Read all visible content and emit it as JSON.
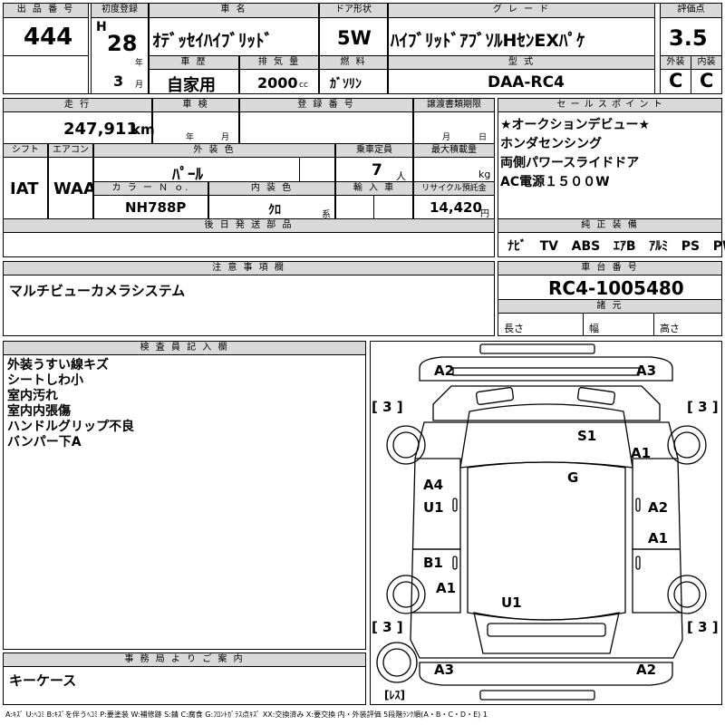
{
  "lot": {
    "header": "出 品 番 号",
    "value": "444"
  },
  "first_reg": {
    "header": "初度登録",
    "era": "H",
    "year": "28",
    "year_unit": "年",
    "month": "3",
    "month_unit": "月"
  },
  "car_name": {
    "header": "車 名",
    "value": "ｵﾃﾞｯｾｲﾊｲﾌﾞﾘｯﾄﾞ"
  },
  "door": {
    "header": "ドア形状",
    "value": "5W"
  },
  "grade": {
    "header": "グ レ ー ド",
    "value": "ﾊｲﾌﾞﾘｯﾄﾞｱﾌﾞｿﾙHｾﾝEXﾊﾟｹ"
  },
  "score": {
    "header": "評価点",
    "value": "3.5",
    "ext_header": "外装",
    "int_header": "内装",
    "ext": "C",
    "int": "C"
  },
  "history": {
    "header": "車 歴",
    "value": "自家用"
  },
  "displacement": {
    "header": "排 気 量",
    "value": "2000",
    "unit": "cc"
  },
  "fuel": {
    "header": "燃 料",
    "value": "ｶﾞｿﾘﾝ"
  },
  "model": {
    "header": "型 式",
    "value": "DAA-RC4"
  },
  "mileage": {
    "header": "走 行",
    "value": "247,911",
    "unit": "km"
  },
  "inspection": {
    "header": "車 検",
    "year_unit": "年",
    "month_unit": "月"
  },
  "reg_number": {
    "header": "登 録 番 号"
  },
  "transfer": {
    "header": "譲渡書類期限",
    "month_unit": "月",
    "day_unit": "日"
  },
  "selling_points": {
    "header": "セ ー ル ス ポ イ ン ト",
    "items": [
      "★オークションデビュー★",
      "ホンダセンシング",
      "両側パワースライドドア",
      "AC電源１５００W"
    ]
  },
  "shift": {
    "header": "シフト",
    "value": "IAT"
  },
  "aircon": {
    "header": "エアコン",
    "value": "WAA"
  },
  "ext_color": {
    "header": "外 装 色",
    "value": "ﾊﾟｰﾙ"
  },
  "capacity": {
    "header": "乗車定員",
    "value": "7",
    "unit": "人"
  },
  "max_load": {
    "header": "最大積載量",
    "unit": "kg"
  },
  "color_no": {
    "header": "カ ラ ー Ｎ ｏ.",
    "value": "NH788P"
  },
  "int_color": {
    "header": "内 装 色",
    "value": "ｸﾛ",
    "unit": "系"
  },
  "import": {
    "header": "輸 入 車"
  },
  "recycle": {
    "header": "リサイクル預託金",
    "value": "14,420",
    "unit": "円"
  },
  "later_parts": {
    "header": "後 日 発 送 部 品"
  },
  "equipment": {
    "header": "純 正 装 備",
    "items": [
      "ﾅﾋﾞ",
      "TV",
      "ABS",
      "ｴｱB",
      "ｱﾙﾐ",
      "PS",
      "PW"
    ]
  },
  "notes": {
    "header": "注 意 事 項 欄",
    "value": "マルチビューカメラシステム"
  },
  "chassis": {
    "header": "車 台 番 号",
    "value": "RC4-1005480"
  },
  "specs": {
    "header": "諸 元",
    "length": "長さ",
    "width": "幅",
    "height": "高さ"
  },
  "inspector": {
    "header": "検 査 員 記 入 欄",
    "items": [
      "外装うすい線キズ",
      "シートしわ小",
      "室内汚れ",
      "室内内張傷",
      "ハンドルグリップ不良",
      "バンパー下A"
    ]
  },
  "office": {
    "header": "事 務 局 よ り ご 案 内",
    "value": "キーケース"
  },
  "diagram": {
    "front_left": "A2",
    "front_right": "A3",
    "tire_fl": "[ 3 ]",
    "tire_fr": "[ 3 ]",
    "roof": "S1",
    "right_front_fender": "A1",
    "windshield": "G",
    "left_front_door": "A4",
    "left_front_door_2": "U1",
    "right_front_door": "A2",
    "right_rear_door": "A1",
    "left_rear_door": "B1",
    "left_rear_fender": "A1",
    "rear_hatch": "U1",
    "tire_rl": "[ 3 ]",
    "tire_rr": "[ 3 ]",
    "rear_left": "A3",
    "rear_right": "A2",
    "spare": "[ﾚｽ]"
  },
  "legend": "A:ｷｽﾞ U:ﾍｺﾐ B:ｷｽﾞを伴うﾍｺﾐ P:要塗装 W:補修跡 S:錆 C:腐食 G:ﾌﾛﾝﾄｶﾞﾗｽ点ｷｽﾞ XX:交換済み X:要交換 内・外装評価 5段階ﾗﾝｸ順(A・B・C・D・E) 1"
}
